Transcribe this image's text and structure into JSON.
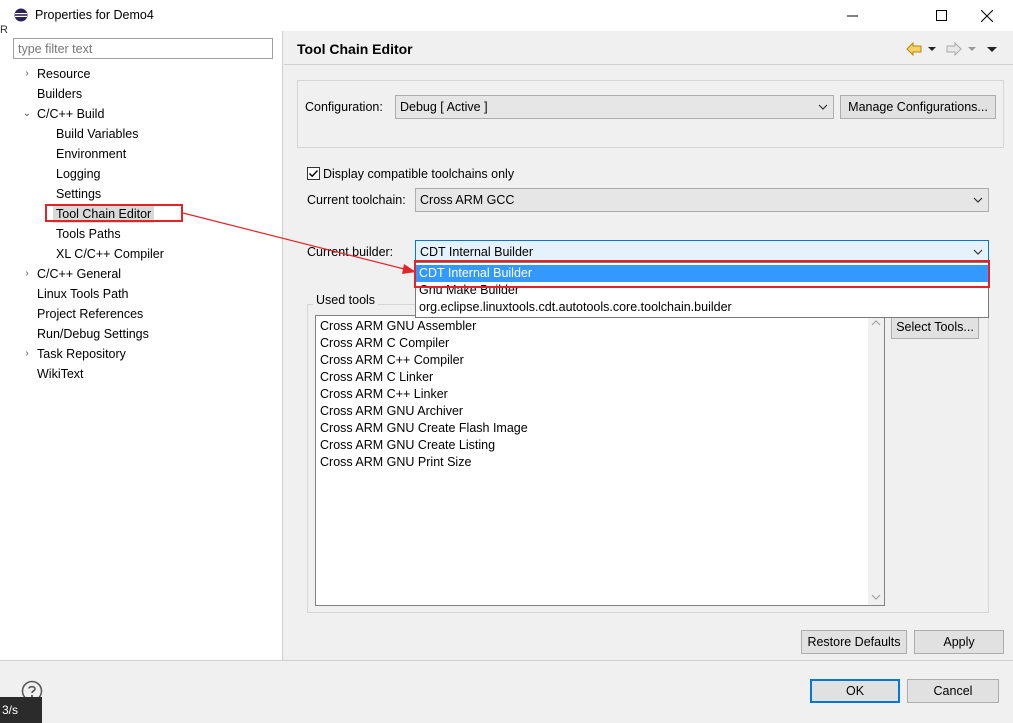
{
  "window": {
    "title": "Properties for Demo4",
    "minimize_glyph": "—",
    "maximize_glyph": "☐",
    "close_glyph": "✕"
  },
  "filter": {
    "placeholder": "type filter text",
    "value": ""
  },
  "tree": {
    "items": [
      {
        "label": "Resource",
        "twisty": "›"
      },
      {
        "label": "Builders",
        "twisty": ""
      },
      {
        "label": "C/C++ Build",
        "twisty": "⌄"
      },
      {
        "label": "Build Variables"
      },
      {
        "label": "Environment"
      },
      {
        "label": "Logging"
      },
      {
        "label": "Settings"
      },
      {
        "label": "Tool Chain Editor"
      },
      {
        "label": "Tools Paths"
      },
      {
        "label": "XL C/C++ Compiler"
      },
      {
        "label": "C/C++ General",
        "twisty": "›"
      },
      {
        "label": "Linux Tools Path"
      },
      {
        "label": "Project References"
      },
      {
        "label": "Run/Debug Settings"
      },
      {
        "label": "Task Repository",
        "twisty": "›"
      },
      {
        "label": "WikiText"
      }
    ]
  },
  "page": {
    "title": "Tool Chain Editor",
    "configuration_label": "Configuration:",
    "configuration_value": "Debug  [ Active ]",
    "manage_button": "Manage Configurations...",
    "compatible_checkbox_label": "Display compatible toolchains only",
    "compatible_checked": true,
    "current_toolchain_label": "Current toolchain:",
    "current_toolchain_value": "Cross ARM GCC",
    "current_builder_label": "Current builder:",
    "current_builder_value": "CDT Internal Builder",
    "builder_options": [
      "CDT Internal Builder",
      "Gnu Make Builder",
      "org.eclipse.linuxtools.cdt.autotools.core.toolchain.builder"
    ],
    "used_tools_label": "Used tools",
    "used_tools": [
      "Cross ARM GNU Assembler",
      "Cross ARM C Compiler",
      "Cross ARM C++ Compiler",
      "Cross ARM C Linker",
      "Cross ARM C++ Linker",
      "Cross ARM GNU Archiver",
      "Cross ARM GNU Create Flash Image",
      "Cross ARM GNU Create Listing",
      "Cross ARM GNU Print Size"
    ],
    "select_tools_button": "Select Tools...",
    "restore_defaults_button": "Restore Defaults",
    "apply_button": "Apply"
  },
  "footer": {
    "ok_button": "OK",
    "cancel_button": "Cancel",
    "taskbar_fragment": "3/s"
  },
  "colors": {
    "selection": "#3399ff",
    "highlight_border": "#e0242a",
    "accent": "#0078d7"
  }
}
